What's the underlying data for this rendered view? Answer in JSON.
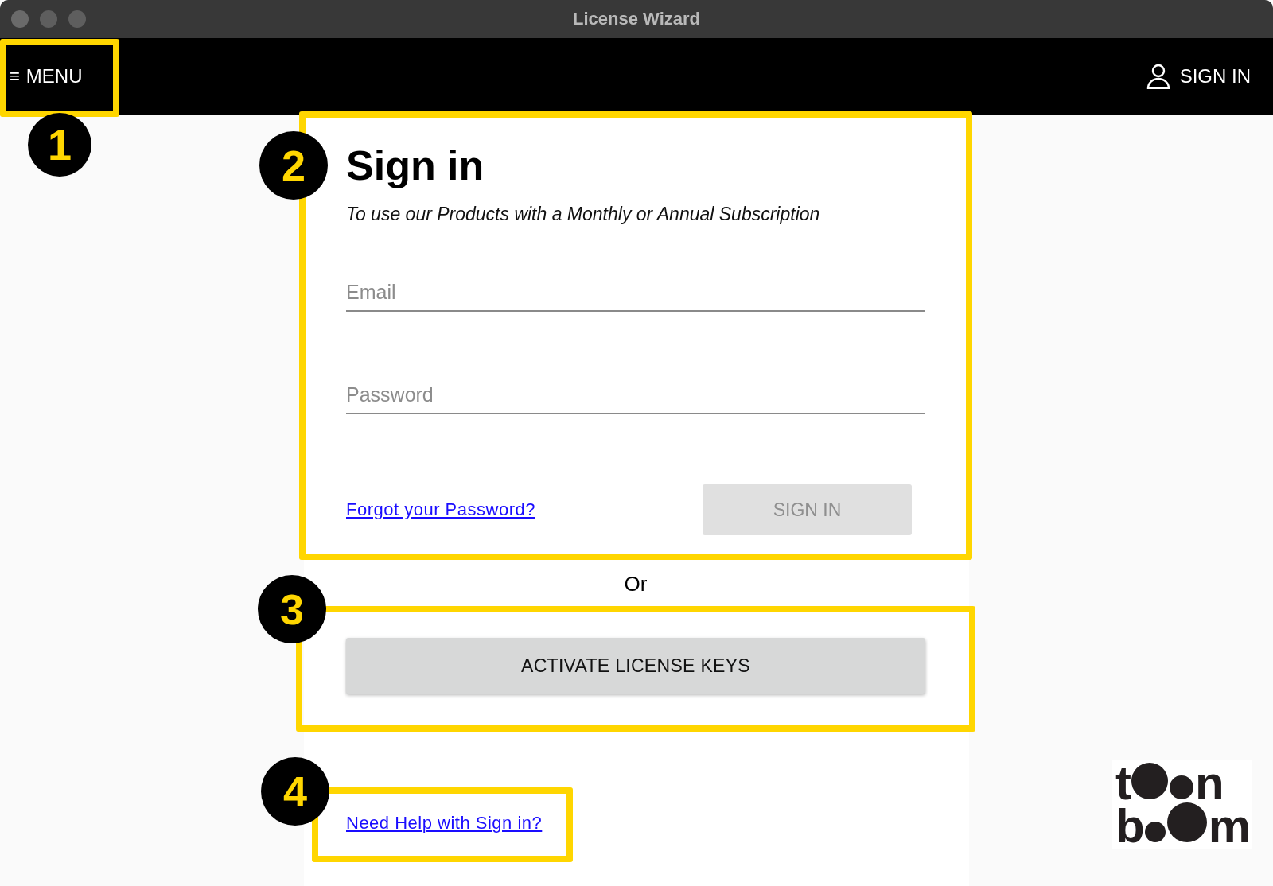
{
  "window": {
    "title": "License Wizard"
  },
  "header": {
    "menu_icon": "≡",
    "menu_label": "MENU",
    "sign_in_label": "SIGN IN"
  },
  "sign_in": {
    "title": "Sign in",
    "subtitle": "To use our Products with a Monthly or Annual Subscription",
    "email": {
      "placeholder": "Email"
    },
    "password": {
      "placeholder": "Password"
    },
    "forgot_link": "Forgot your Password?",
    "submit": {
      "label": "SIGN IN",
      "disabled": true
    }
  },
  "separator": "Or",
  "activate_button": "ACTIVATE LICENSE KEYS",
  "help_link": "Need Help with Sign in?",
  "logo": {
    "top_first": "t",
    "top_last": "n",
    "bottom_first": "b",
    "bottom_last": "m"
  },
  "callouts": [
    {
      "number": "1"
    },
    {
      "number": "2"
    },
    {
      "number": "3"
    },
    {
      "number": "4"
    }
  ]
}
